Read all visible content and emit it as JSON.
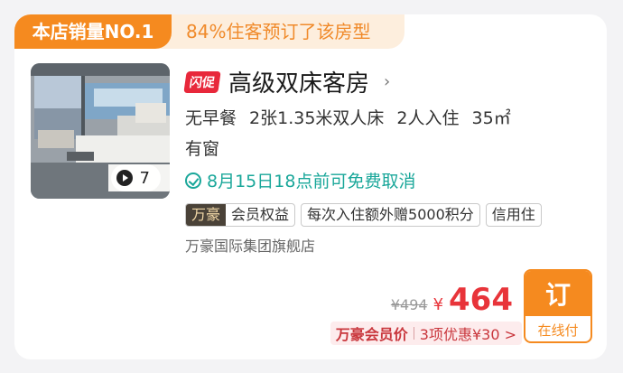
{
  "banner": {
    "sales_badge": "本店销量NO.1",
    "booked_text": "84%住客预订了该房型"
  },
  "room": {
    "photo_count": "7",
    "flash_badge": "闪促",
    "title": "高级双床客房",
    "chevron": "›",
    "specs": [
      "无早餐",
      "2张1.35米双人床",
      "2人入住",
      "35㎡"
    ],
    "window": "有窗",
    "cancel_policy": "8月15日18点前可免费取消",
    "tags": {
      "brand": "万豪",
      "member_benefit": "会员权益",
      "bonus_points": "每次入住额外赠5000积分",
      "credit_stay": "信用住"
    },
    "group": "万豪国际集团旗舰店"
  },
  "price": {
    "original": "¥494",
    "currency": "¥",
    "current": "464",
    "member_label": "万豪会员价",
    "member_deal": "3项优惠¥30 >"
  },
  "book_button": {
    "label": "订",
    "sub_label": "在线付"
  },
  "colors": {
    "accent_orange": "#f58a1f",
    "price_red": "#e8343a",
    "cancel_green": "#1aa79a"
  }
}
